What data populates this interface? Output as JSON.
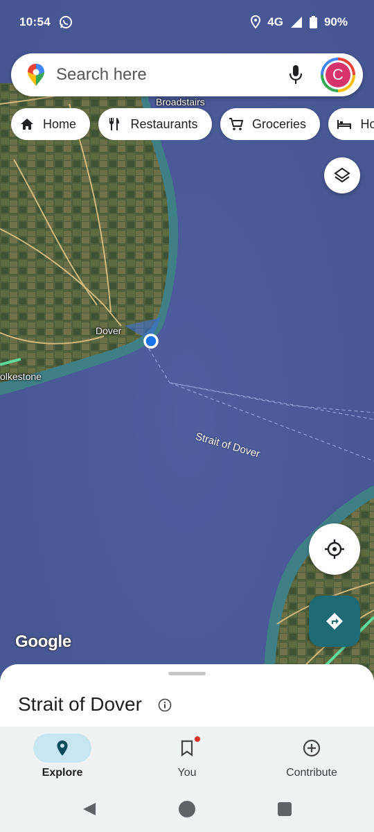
{
  "status_bar": {
    "time": "10:54",
    "network": "4G",
    "battery": "90%"
  },
  "search": {
    "placeholder": "Search here",
    "avatar_letter": "C"
  },
  "chips": [
    {
      "label": "Home",
      "icon": "home-icon"
    },
    {
      "label": "Restaurants",
      "icon": "restaurant-icon"
    },
    {
      "label": "Groceries",
      "icon": "cart-icon"
    },
    {
      "label": "Ho",
      "icon": "hotel-icon"
    }
  ],
  "map": {
    "labels": {
      "broadstairs": "Broadstairs",
      "dover": "Dover",
      "folkestone": "olkestone",
      "strait": "Strait of Dover"
    },
    "logo": "Google",
    "colors": {
      "sea": "#4a5a9a",
      "land": "#4d5e3a",
      "location_dot": "#1a73e8",
      "directions_button": "#1f6b75"
    }
  },
  "sheet": {
    "title": "Strait of Dover"
  },
  "bottom_nav": {
    "items": [
      {
        "label": "Explore",
        "icon": "explore-pin-icon",
        "active": true
      },
      {
        "label": "You",
        "icon": "bookmark-icon",
        "active": false,
        "notification_dot": true
      },
      {
        "label": "Contribute",
        "icon": "add-circle-icon",
        "active": false
      }
    ]
  }
}
